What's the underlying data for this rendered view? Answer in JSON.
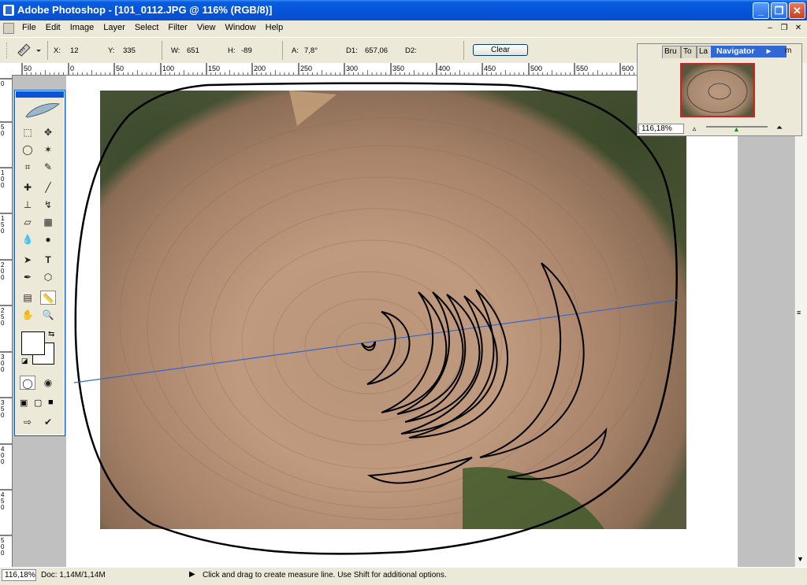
{
  "window": {
    "title": "Adobe Photoshop - [101_0112.JPG @ 116% (RGB/8)]",
    "minimize_icon": "minimize-icon",
    "maximize_icon": "restore-icon",
    "close_icon": "close-icon"
  },
  "menu": {
    "items": [
      "File",
      "Edit",
      "Image",
      "Layer",
      "Select",
      "Filter",
      "View",
      "Window",
      "Help"
    ]
  },
  "options_bar": {
    "tool_icon": "ruler-icon",
    "x_label": "X:",
    "x_value": "12",
    "y_label": "Y:",
    "y_value": "335",
    "w_label": "W:",
    "w_value": "651",
    "h_label": "H:",
    "h_value": "-89",
    "a_label": "A:",
    "a_value": "7,8°",
    "d1_label": "D1:",
    "d1_value": "657,06",
    "d2_label": "D2:",
    "d2_value": "",
    "clear_label": "Clear"
  },
  "rulers": {
    "horizontal_ticks": [
      "50",
      "0",
      "50",
      "100",
      "150",
      "200",
      "250",
      "300",
      "350",
      "400",
      "450",
      "500",
      "550",
      "600"
    ],
    "vertical_ticks": [
      "0",
      "5 0",
      "1 0 0",
      "1 5 0",
      "2 0 0",
      "2 5 0",
      "3 0 0",
      "3 5 0",
      "4 0 0",
      "4 5 0",
      "5 0 0"
    ]
  },
  "navigator": {
    "tabs": [
      "Bru",
      "To",
      "La"
    ],
    "active_tab": "Navigator",
    "zoom": "116,18%"
  },
  "status": {
    "zoom": "116,18%",
    "doc": "Doc: 1,14M/1,14M",
    "hint": "Click and drag to create measure line.  Use Shift for additional options."
  },
  "colors": {
    "title_bar": "#0653d8",
    "chrome": "#ece9d8",
    "measure_line": "#3a66c8"
  }
}
